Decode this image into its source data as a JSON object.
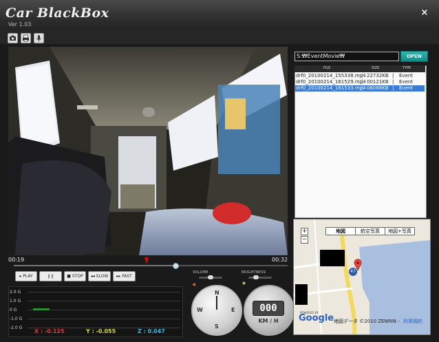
{
  "window": {
    "title": "Car BlackBox",
    "version": "Ver 1.03",
    "close_label": "×"
  },
  "toolbar": {
    "icons": [
      "camera-icon",
      "print-icon",
      "microphone-icon"
    ]
  },
  "player": {
    "time_start": "00:19",
    "time_end": "00:32",
    "progress": 0.59,
    "buttons": {
      "play": "▸ PLAY",
      "pause": "❙❙ PAUSE",
      "stop": "■ STOP",
      "slow": "◂◂ SLOW",
      "fast": "▸▸ FAST"
    },
    "volume_label": "VOLUME",
    "brightness_label": "BRIGHTNESS"
  },
  "graph": {
    "y_labels": [
      "2.0 G",
      "1.0 G",
      "0 G",
      "-1.0 G",
      "-2.0 G"
    ],
    "readouts": {
      "x": "X : -0.125",
      "y": "Y : -0.055",
      "z": "Z : 0.047"
    },
    "colors": {
      "x": "#e03a3a",
      "y": "#d8d830",
      "z": "#3ab8e0",
      "trace": "#2e8a2e"
    }
  },
  "compass": {
    "n": "N",
    "e": "E",
    "s": "S",
    "w": "W"
  },
  "speedometer": {
    "value": "000",
    "unit": "KM / H"
  },
  "files": {
    "path": "S:₩EventMovie₩",
    "open_label": "OPEN",
    "columns": {
      "file": "FILE",
      "size": "SIZE",
      "type": "TYPE"
    },
    "rows": [
      {
        "file": "drf0_20100214_155338.mp4",
        "size": "22732KB",
        "type": "Event",
        "selected": false
      },
      {
        "file": "drf0_20100214_161529.mp4",
        "size": "00121KB",
        "type": "Event",
        "selected": false
      },
      {
        "file": "drf0_20100214_161533.mp4",
        "size": "06088KB",
        "type": "Event",
        "selected": true
      }
    ]
  },
  "map": {
    "tabs": {
      "map": "地図",
      "satellite": "航空写真",
      "hybrid": "地図+写真"
    },
    "zoom_in": "+",
    "zoom_out": "−",
    "route_number": "47",
    "powered_by": "POWERED BY",
    "logo": "Google",
    "attribution": "地図データ ©2010 ZENRIN -",
    "terms": "利用規約"
  }
}
